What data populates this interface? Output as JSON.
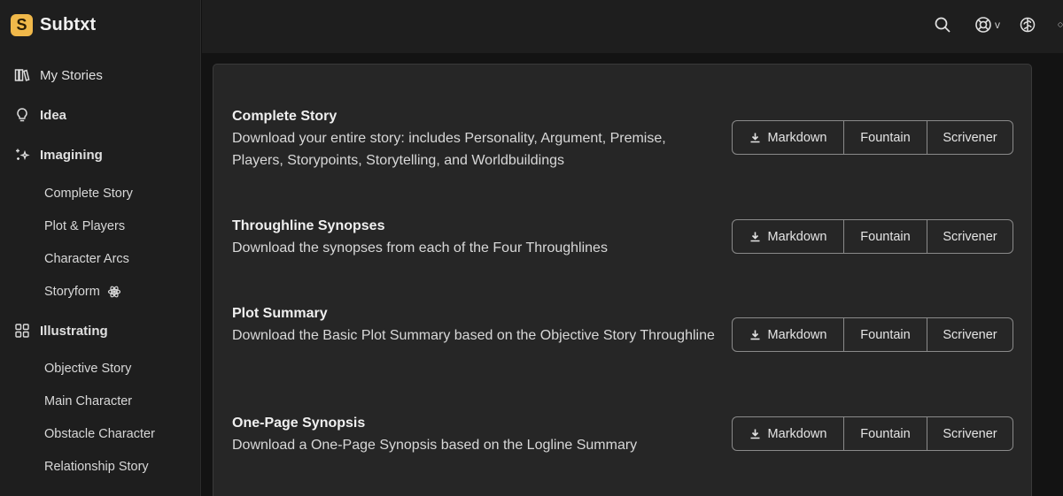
{
  "brand": {
    "logo_letter": "S",
    "name": "Subtxt"
  },
  "sidebar": {
    "nav": [
      {
        "label": "My Stories",
        "icon": "books-icon"
      },
      {
        "label": "Idea",
        "icon": "lightbulb-icon"
      },
      {
        "label": "Imagining",
        "icon": "sparkles-icon"
      },
      {
        "label": "Illustrating",
        "icon": "grid-icon"
      }
    ],
    "imagining_items": [
      "Complete Story",
      "Plot & Players",
      "Character Arcs",
      "Storyform"
    ],
    "illustrating_items": [
      "Objective Story",
      "Main Character",
      "Obstacle Character",
      "Relationship Story"
    ]
  },
  "topbar": {
    "icons": [
      "search-icon",
      "help-icon",
      "chevron-down-icon",
      "brain-icon"
    ],
    "help_caret": "v"
  },
  "exports": [
    {
      "title": "Complete Story",
      "description": "Download your entire story: includes Personality, Argument, Premise, Players, Storypoints, Storytelling, and Worldbuildings"
    },
    {
      "title": "Throughline Synopses",
      "description": "Download the synopses from each of the Four Throughlines"
    },
    {
      "title": "Plot Summary",
      "description": "Download the Basic Plot Summary based on the Objective Story Throughline"
    },
    {
      "title": "One-Page Synopsis",
      "description": "Download a One-Page Synopsis based on the Logline Summary"
    }
  ],
  "buttons": {
    "markdown": "Markdown",
    "fountain": "Fountain",
    "scrivener": "Scrivener"
  }
}
